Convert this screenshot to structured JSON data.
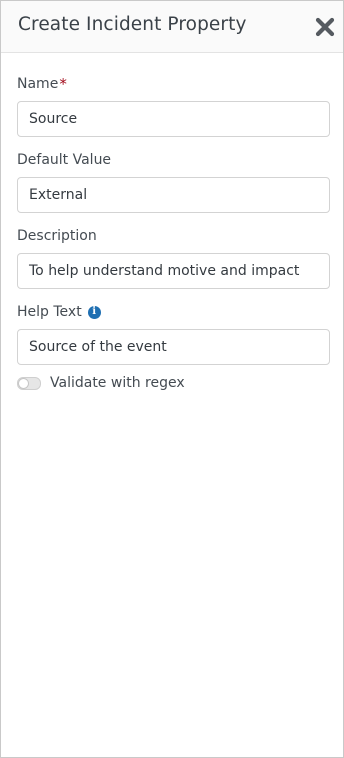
{
  "header": {
    "title": "Create Incident Property"
  },
  "fields": [
    {
      "label": "Name",
      "required_mark": "*",
      "value": "Source"
    },
    {
      "label": "Default Value",
      "value": "External"
    },
    {
      "label": "Description",
      "value": "To help understand motive and impact"
    },
    {
      "label": "Help Text",
      "value": "Source of the event",
      "info_icon": "i"
    }
  ],
  "regex_toggle": {
    "label": "Validate with regex",
    "enabled": false
  },
  "colors": {
    "required": "#a30d1d",
    "info": "#1f6fb2",
    "close_icon": "#555a60"
  }
}
